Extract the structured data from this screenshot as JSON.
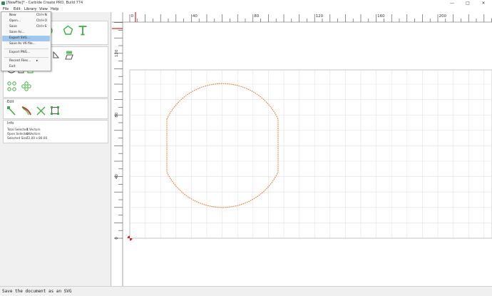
{
  "window": {
    "title": "[NewFile]* - Carbide Create PRO, Build 774",
    "controls": [
      "—",
      "□",
      "✕"
    ]
  },
  "menubar": {
    "items": [
      "File",
      "Edit",
      "Library",
      "View",
      "Help"
    ]
  },
  "file_menu": {
    "items": [
      {
        "label": "New",
        "shortcut": "Ctrl+N"
      },
      {
        "label": "Open...",
        "shortcut": "Ctrl+O"
      },
      {
        "label": "Save",
        "shortcut": "Ctrl+S"
      },
      {
        "label": "Save As...",
        "shortcut": ""
      },
      {
        "label": "Export SVG...",
        "shortcut": ""
      },
      {
        "label": "Save As V6 file...",
        "shortcut": ""
      },
      {
        "label": "Export PNG...",
        "shortcut": ""
      },
      {
        "label": "Recent Files...",
        "shortcut": "▸"
      },
      {
        "label": "Exit",
        "shortcut": ""
      }
    ],
    "highlighted": "Export SVG..."
  },
  "panel": {
    "edit_section_title": "Edit",
    "info_section_title": "Info",
    "info": {
      "total_selected_label": "Total Selected:",
      "total_selected_value": "1 Vectors",
      "open_selected_label": "Open Selected:",
      "open_selected_value": "0 Vectors",
      "selected_size_label": "Selected Size:",
      "selected_size_value": "72.00 x 80.00"
    }
  },
  "rulers": {
    "top_labels": [
      "0",
      "40",
      "80",
      "120",
      "160",
      "200"
    ],
    "left_labels": [
      "120",
      "80",
      "40",
      "0"
    ]
  },
  "colors": {
    "accent_green": "#3cae3c",
    "selection_orange": "#f07020",
    "origin_red": "#e02020",
    "menu_highlight": "#9fc8ec"
  },
  "status": {
    "text": "Save the document as an SVG"
  }
}
